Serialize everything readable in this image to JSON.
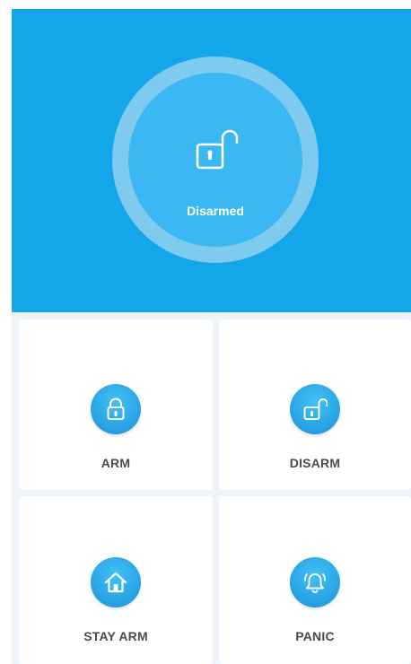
{
  "status": {
    "label": "Disarmed",
    "icon": "unlocked-padlock-icon"
  },
  "actions": [
    {
      "label": "ARM",
      "icon": "locked-padlock-icon"
    },
    {
      "label": "DISARM",
      "icon": "unlocked-padlock-icon"
    },
    {
      "label": "STAY ARM",
      "icon": "house-icon"
    },
    {
      "label": "PANIC",
      "icon": "alarm-bell-icon"
    }
  ],
  "colors": {
    "primary": "#13a6ea",
    "ring": "#7fcbef",
    "core": "#3bb8f3",
    "grid_background": "#eef4fb",
    "label_text": "#4a4a4a"
  }
}
